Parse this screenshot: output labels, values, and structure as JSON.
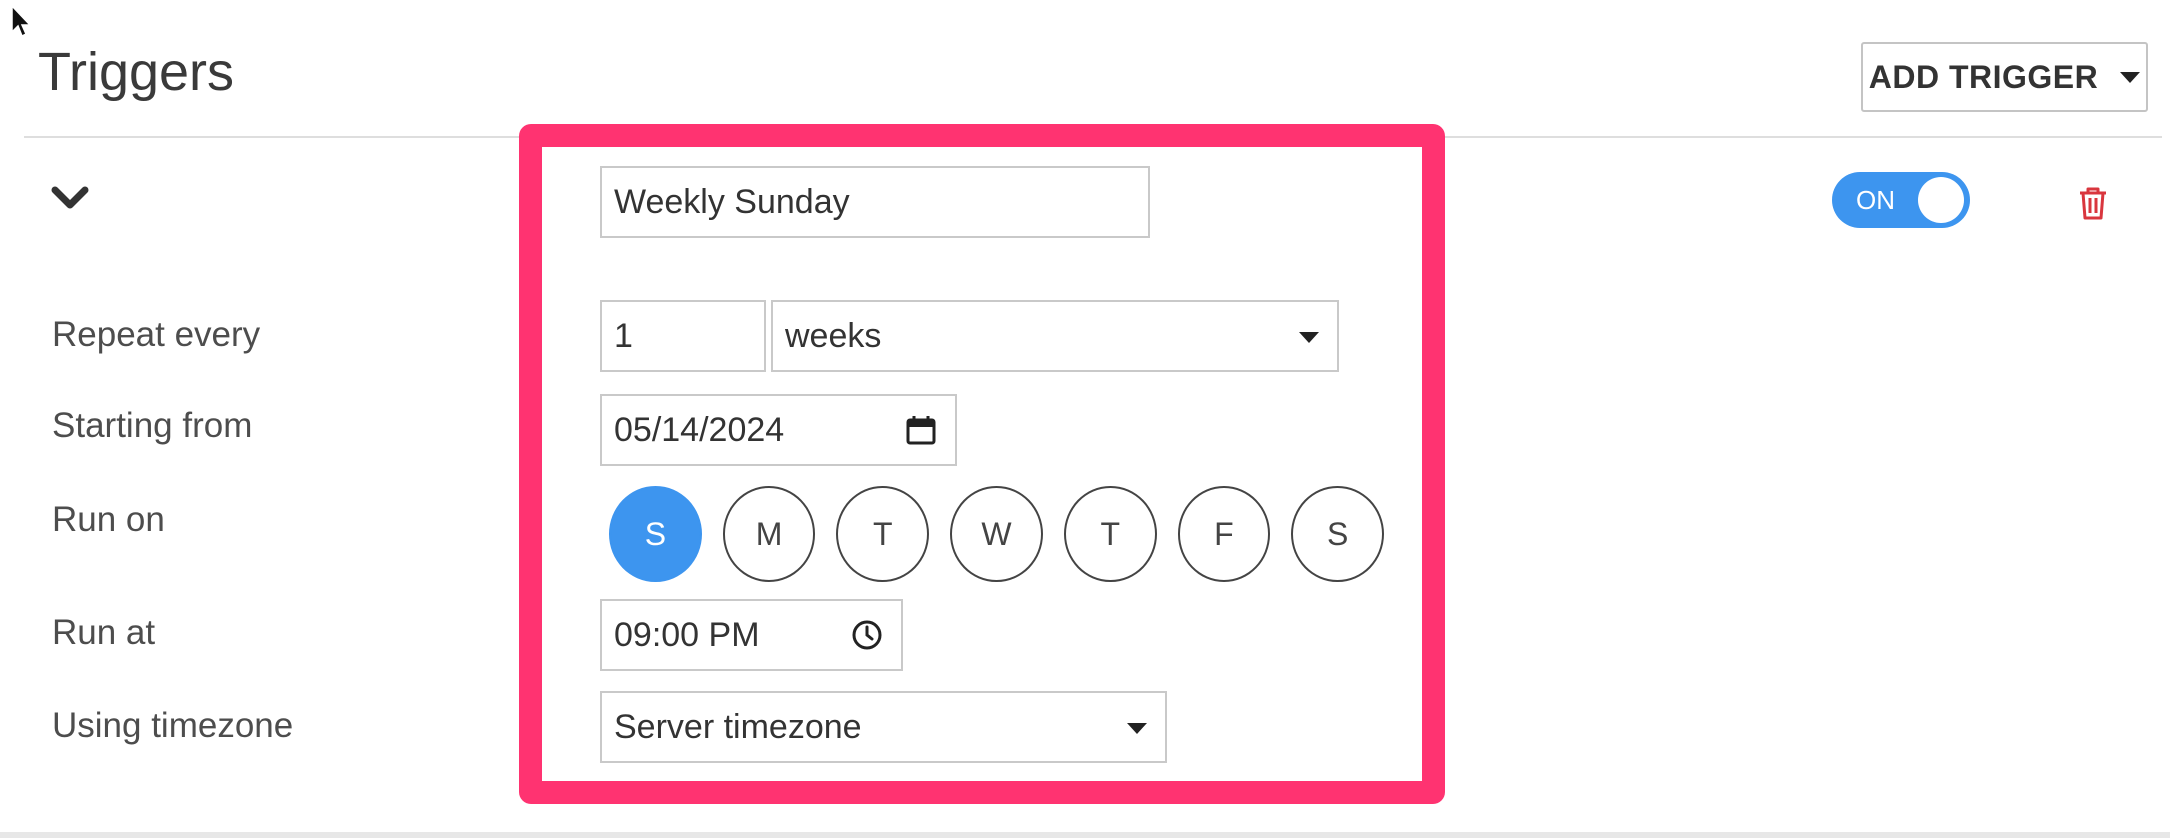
{
  "header": {
    "title": "Triggers",
    "add_trigger_label": "ADD TRIGGER"
  },
  "trigger": {
    "enabled": true,
    "toggle_label": "ON",
    "name_value": "Weekly Sunday",
    "labels": {
      "repeat_every": "Repeat every",
      "starting_from": "Starting from",
      "run_on": "Run on",
      "run_at": "Run at",
      "using_timezone": "Using timezone"
    },
    "repeat_count": "1",
    "repeat_unit": "weeks",
    "start_date": "05/14/2024",
    "days": [
      {
        "label": "S",
        "selected": true
      },
      {
        "label": "M",
        "selected": false
      },
      {
        "label": "T",
        "selected": false
      },
      {
        "label": "W",
        "selected": false
      },
      {
        "label": "T",
        "selected": false
      },
      {
        "label": "F",
        "selected": false
      },
      {
        "label": "S",
        "selected": false
      }
    ],
    "run_at_time": "09:00 PM",
    "timezone": "Server timezone"
  },
  "colors": {
    "accent": "#3d95ef",
    "highlight": "#ff3371",
    "delete": "#d9363e"
  },
  "icons": [
    "cursor-icon",
    "caret-down-icon",
    "chevron-down-icon",
    "trash-icon",
    "calendar-icon",
    "clock-icon"
  ]
}
